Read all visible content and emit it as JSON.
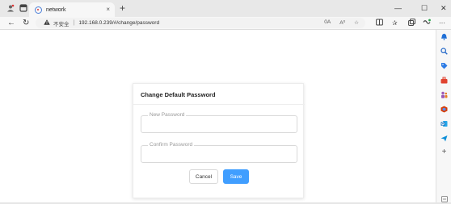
{
  "tab": {
    "title": "network",
    "close": "×",
    "new_tab": "+"
  },
  "window_controls": {
    "minimize": "—",
    "maximize": "☐",
    "close": "✕"
  },
  "nav": {
    "back": "←",
    "reload": "↻"
  },
  "address_bar": {
    "security_label": "不安全",
    "separator": "|",
    "url": "192.168.0.239/#/change/password",
    "zoom_text": "0A",
    "read_aloud_text": "A⁰"
  },
  "card": {
    "title": "Change Default Password",
    "new_password_label": "New Password",
    "new_password_value": "",
    "confirm_password_label": "Confirm Password",
    "confirm_password_value": "",
    "cancel_label": "Cancel",
    "save_label": "Save"
  },
  "sidebar": {
    "add_label": "+",
    "icon_colors": {
      "bell": "#1f6fd6",
      "search": "#2a6cc9",
      "tag": "#2c7be5",
      "toolbox": "#e0422f",
      "people": "#9b59b6",
      "office": "#d83b01",
      "outlook": "#0f6cbd",
      "send": "#0e8fd8"
    }
  },
  "colors": {
    "primary": "#409eff"
  }
}
